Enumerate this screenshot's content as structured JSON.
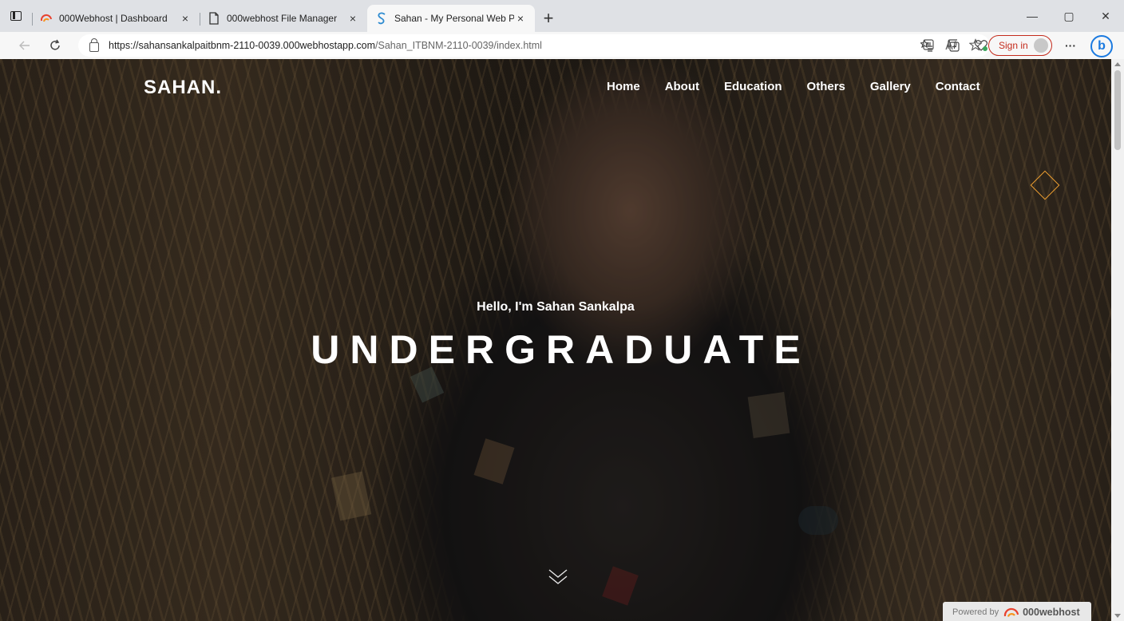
{
  "browser": {
    "tabs": [
      {
        "title": "000Webhost | Dashboard",
        "icon": "000webhost-logo-icon",
        "active": false
      },
      {
        "title": "000webhost File Manager",
        "icon": "page-icon",
        "active": false
      },
      {
        "title": "Sahan - My Personal Web Page",
        "icon": "site-s-icon",
        "active": true
      }
    ],
    "url_main": "https://sahansankalpaitbnm-2110-0039.000webhostapp.com",
    "url_rest": "/Sahan_ITBNM-2110-0039/index.html",
    "sign_in_label": "Sign in",
    "more_label": "···",
    "bing_label": "b",
    "new_tab_label": "+",
    "close_tab_label": "×",
    "win_controls": {
      "minimize": "—",
      "restore": "▢",
      "close": "✕"
    }
  },
  "site": {
    "brand": "SAHAN.",
    "nav": [
      "Home",
      "About",
      "Education",
      "Others",
      "Gallery",
      "Contact"
    ],
    "greeting": "Hello, I'm Sahan Sankalpa",
    "headline": "UNDERGRADUATE",
    "accent_color": "#f0a030"
  },
  "badge": {
    "prefix": "Powered by",
    "name": "000webhost"
  }
}
